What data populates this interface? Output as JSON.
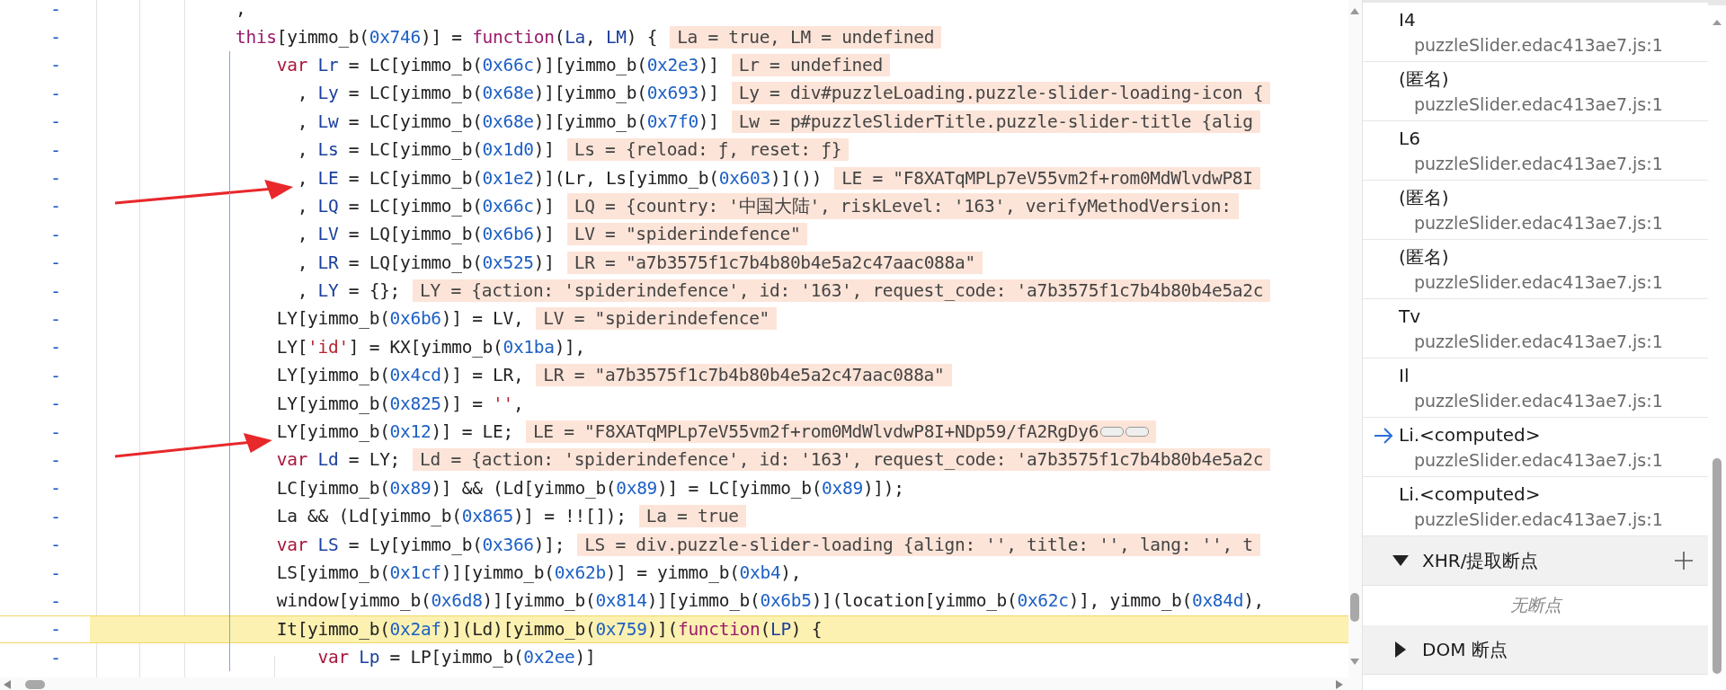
{
  "editor": {
    "lines": [
      {
        "marker": "-",
        "current": false,
        "arrow": false,
        "tokens": [
          {
            "kind": "plain",
            "text": ","
          }
        ]
      },
      {
        "marker": "-",
        "current": false,
        "arrow": false,
        "tokens": [
          {
            "kind": "keyword",
            "text": "this"
          },
          {
            "kind": "plain",
            "text": "[yimmo_b("
          },
          {
            "kind": "number",
            "text": "0x746"
          },
          {
            "kind": "plain",
            "text": ")] = "
          },
          {
            "kind": "keyword",
            "text": "function"
          },
          {
            "kind": "plain",
            "text": "("
          },
          {
            "kind": "def",
            "text": "La"
          },
          {
            "kind": "plain",
            "text": ", "
          },
          {
            "kind": "def",
            "text": "LM"
          },
          {
            "kind": "plain",
            "text": ") {"
          }
        ],
        "value": "La = true, LM = undefined"
      },
      {
        "marker": "-",
        "current": false,
        "arrow": false,
        "tokens": [
          {
            "kind": "storage",
            "text": "    var"
          },
          {
            "kind": "def",
            "text": " Lr"
          },
          {
            "kind": "plain",
            "text": " = LC[yimmo_b("
          },
          {
            "kind": "number",
            "text": "0x66c"
          },
          {
            "kind": "plain",
            "text": ")][yimmo_b("
          },
          {
            "kind": "number",
            "text": "0x2e3"
          },
          {
            "kind": "plain",
            "text": ")]"
          }
        ],
        "value": "Lr = undefined"
      },
      {
        "marker": "-",
        "current": false,
        "arrow": false,
        "tokens": [
          {
            "kind": "plain",
            "text": "      , "
          },
          {
            "kind": "def",
            "text": "Ly"
          },
          {
            "kind": "plain",
            "text": " = LC[yimmo_b("
          },
          {
            "kind": "number",
            "text": "0x68e"
          },
          {
            "kind": "plain",
            "text": ")][yimmo_b("
          },
          {
            "kind": "number",
            "text": "0x693"
          },
          {
            "kind": "plain",
            "text": ")]"
          }
        ],
        "value": "Ly = div#puzzleLoading.puzzle-slider-loading-icon {"
      },
      {
        "marker": "-",
        "current": false,
        "arrow": false,
        "tokens": [
          {
            "kind": "plain",
            "text": "      , "
          },
          {
            "kind": "def",
            "text": "Lw"
          },
          {
            "kind": "plain",
            "text": " = LC[yimmo_b("
          },
          {
            "kind": "number",
            "text": "0x68e"
          },
          {
            "kind": "plain",
            "text": ")][yimmo_b("
          },
          {
            "kind": "number",
            "text": "0x7f0"
          },
          {
            "kind": "plain",
            "text": ")]"
          }
        ],
        "value": "Lw = p#puzzleSliderTitle.puzzle-slider-title {alig"
      },
      {
        "marker": "-",
        "current": false,
        "arrow": false,
        "tokens": [
          {
            "kind": "plain",
            "text": "      , "
          },
          {
            "kind": "def",
            "text": "Ls"
          },
          {
            "kind": "plain",
            "text": " = LC[yimmo_b("
          },
          {
            "kind": "number",
            "text": "0x1d0"
          },
          {
            "kind": "plain",
            "text": ")]"
          }
        ],
        "value": "Ls = {reload: ƒ, reset: ƒ}"
      },
      {
        "marker": "-",
        "current": false,
        "arrow": true,
        "tokens": [
          {
            "kind": "plain",
            "text": "      , "
          },
          {
            "kind": "def",
            "text": "LE"
          },
          {
            "kind": "plain",
            "text": " = LC[yimmo_b("
          },
          {
            "kind": "number",
            "text": "0x1e2"
          },
          {
            "kind": "plain",
            "text": ")](Lr, Ls[yimmo_b("
          },
          {
            "kind": "number",
            "text": "0x603"
          },
          {
            "kind": "plain",
            "text": ")]())"
          }
        ],
        "value": "LE = \"F8XATqMPLp7eV55vm2f+rom0MdWlvdwP8I"
      },
      {
        "marker": "-",
        "current": false,
        "arrow": false,
        "tokens": [
          {
            "kind": "plain",
            "text": "      , "
          },
          {
            "kind": "def",
            "text": "LQ"
          },
          {
            "kind": "plain",
            "text": " = LC[yimmo_b("
          },
          {
            "kind": "number",
            "text": "0x66c"
          },
          {
            "kind": "plain",
            "text": ")]"
          }
        ],
        "value": "LQ = {country: '中国大陆', riskLevel: '163', verifyMethodVersion:"
      },
      {
        "marker": "-",
        "current": false,
        "arrow": false,
        "tokens": [
          {
            "kind": "plain",
            "text": "      , "
          },
          {
            "kind": "def",
            "text": "LV"
          },
          {
            "kind": "plain",
            "text": " = LQ[yimmo_b("
          },
          {
            "kind": "number",
            "text": "0x6b6"
          },
          {
            "kind": "plain",
            "text": ")]"
          }
        ],
        "value": "LV = \"spiderindefence\""
      },
      {
        "marker": "-",
        "current": false,
        "arrow": false,
        "tokens": [
          {
            "kind": "plain",
            "text": "      , "
          },
          {
            "kind": "def",
            "text": "LR"
          },
          {
            "kind": "plain",
            "text": " = LQ[yimmo_b("
          },
          {
            "kind": "number",
            "text": "0x525"
          },
          {
            "kind": "plain",
            "text": ")]"
          }
        ],
        "value": "LR = \"a7b3575f1c7b4b80b4e5a2c47aac088a\""
      },
      {
        "marker": "-",
        "current": false,
        "arrow": false,
        "tokens": [
          {
            "kind": "plain",
            "text": "      , "
          },
          {
            "kind": "def",
            "text": "LY"
          },
          {
            "kind": "plain",
            "text": " = {};"
          }
        ],
        "value": "LY = {action: 'spiderindefence', id: '163', request_code: 'a7b3575f1c7b4b80b4e5a2c"
      },
      {
        "marker": "-",
        "current": false,
        "arrow": false,
        "tokens": [
          {
            "kind": "plain",
            "text": "    LY[yimmo_b("
          },
          {
            "kind": "number",
            "text": "0x6b6"
          },
          {
            "kind": "plain",
            "text": ")] = LV,"
          }
        ],
        "value": "LV = \"spiderindefence\""
      },
      {
        "marker": "-",
        "current": false,
        "arrow": false,
        "tokens": [
          {
            "kind": "plain",
            "text": "    LY["
          },
          {
            "kind": "string",
            "text": "'id'"
          },
          {
            "kind": "plain",
            "text": "] = KX[yimmo_b("
          },
          {
            "kind": "number",
            "text": "0x1ba"
          },
          {
            "kind": "plain",
            "text": ")],"
          }
        ]
      },
      {
        "marker": "-",
        "current": false,
        "arrow": false,
        "tokens": [
          {
            "kind": "plain",
            "text": "    LY[yimmo_b("
          },
          {
            "kind": "number",
            "text": "0x4cd"
          },
          {
            "kind": "plain",
            "text": ")] = LR,"
          }
        ],
        "value": "LR = \"a7b3575f1c7b4b80b4e5a2c47aac088a\""
      },
      {
        "marker": "-",
        "current": false,
        "arrow": false,
        "tokens": [
          {
            "kind": "plain",
            "text": "    LY[yimmo_b("
          },
          {
            "kind": "number",
            "text": "0x825"
          },
          {
            "kind": "plain",
            "text": ")] = "
          },
          {
            "kind": "string",
            "text": "''"
          },
          {
            "kind": "plain",
            "text": ","
          }
        ]
      },
      {
        "marker": "-",
        "current": false,
        "arrow": true,
        "tokens": [
          {
            "kind": "plain",
            "text": "    LY[yimmo_b("
          },
          {
            "kind": "number",
            "text": "0x12"
          },
          {
            "kind": "plain",
            "text": ")] = LE;"
          }
        ],
        "value": "LE = \"F8XATqMPLp7eV55vm2f+rom0MdWlvdwP8I+NDp59/fA2RgDy6",
        "value_truncated": true
      },
      {
        "marker": "-",
        "current": false,
        "arrow": false,
        "tokens": [
          {
            "kind": "storage",
            "text": "    var"
          },
          {
            "kind": "def",
            "text": " Ld"
          },
          {
            "kind": "plain",
            "text": " = LY;"
          }
        ],
        "value": "Ld = {action: 'spiderindefence', id: '163', request_code: 'a7b3575f1c7b4b80b4e5a2c"
      },
      {
        "marker": "-",
        "current": false,
        "arrow": false,
        "tokens": [
          {
            "kind": "plain",
            "text": "    LC[yimmo_b("
          },
          {
            "kind": "number",
            "text": "0x89"
          },
          {
            "kind": "plain",
            "text": ")] && (Ld[yimmo_b("
          },
          {
            "kind": "number",
            "text": "0x89"
          },
          {
            "kind": "plain",
            "text": ")] = LC[yimmo_b("
          },
          {
            "kind": "number",
            "text": "0x89"
          },
          {
            "kind": "plain",
            "text": ")]);"
          }
        ]
      },
      {
        "marker": "-",
        "current": false,
        "arrow": false,
        "tokens": [
          {
            "kind": "plain",
            "text": "    La && (Ld[yimmo_b("
          },
          {
            "kind": "number",
            "text": "0x865"
          },
          {
            "kind": "plain",
            "text": ")] = !![]);"
          }
        ],
        "value": "La = true"
      },
      {
        "marker": "-",
        "current": false,
        "arrow": false,
        "tokens": [
          {
            "kind": "storage",
            "text": "    var"
          },
          {
            "kind": "def",
            "text": " LS"
          },
          {
            "kind": "plain",
            "text": " = Ly[yimmo_b("
          },
          {
            "kind": "number",
            "text": "0x366"
          },
          {
            "kind": "plain",
            "text": ")];"
          }
        ],
        "value": "LS = div.puzzle-slider-loading {align: '', title: '', lang: '', t"
      },
      {
        "marker": "-",
        "current": false,
        "arrow": false,
        "tokens": [
          {
            "kind": "plain",
            "text": "    LS[yimmo_b("
          },
          {
            "kind": "number",
            "text": "0x1cf"
          },
          {
            "kind": "plain",
            "text": ")][yimmo_b("
          },
          {
            "kind": "number",
            "text": "0x62b"
          },
          {
            "kind": "plain",
            "text": ")] = yimmo_b("
          },
          {
            "kind": "number",
            "text": "0xb4"
          },
          {
            "kind": "plain",
            "text": "),"
          }
        ]
      },
      {
        "marker": "-",
        "current": false,
        "arrow": false,
        "tokens": [
          {
            "kind": "plain",
            "text": "    window[yimmo_b("
          },
          {
            "kind": "number",
            "text": "0x6d8"
          },
          {
            "kind": "plain",
            "text": ")][yimmo_b("
          },
          {
            "kind": "number",
            "text": "0x814"
          },
          {
            "kind": "plain",
            "text": ")][yimmo_b("
          },
          {
            "kind": "number",
            "text": "0x6b5"
          },
          {
            "kind": "plain",
            "text": ")](location[yimmo_b("
          },
          {
            "kind": "number",
            "text": "0x62c"
          },
          {
            "kind": "plain",
            "text": ")], yimmo_b("
          },
          {
            "kind": "number",
            "text": "0x84d"
          },
          {
            "kind": "plain",
            "text": "),"
          }
        ]
      },
      {
        "marker": "-",
        "current": true,
        "arrow": false,
        "tokens": [
          {
            "kind": "plain",
            "text": "    It[yimmo_b("
          },
          {
            "kind": "number",
            "text": "0x2af"
          },
          {
            "kind": "plain",
            "text": ")](Ld)[yimmo_b("
          },
          {
            "kind": "number",
            "text": "0x759"
          },
          {
            "kind": "plain",
            "text": ")]("
          },
          {
            "kind": "keyword",
            "text": "function"
          },
          {
            "kind": "plain",
            "text": "("
          },
          {
            "kind": "def",
            "text": "LP"
          },
          {
            "kind": "plain",
            "text": ") {"
          }
        ]
      },
      {
        "marker": "-",
        "current": false,
        "arrow": false,
        "tokens": [
          {
            "kind": "storage",
            "text": "        var"
          },
          {
            "kind": "def",
            "text": " Lp"
          },
          {
            "kind": "plain",
            "text": " = LP[yimmo_b("
          },
          {
            "kind": "number",
            "text": "0x2ee"
          },
          {
            "kind": "plain",
            "text": ")]"
          }
        ]
      }
    ]
  },
  "call_stack": {
    "frames": [
      {
        "name": "I4",
        "location": "puzzleSlider.edac413ae7.js:1",
        "selected": false
      },
      {
        "name": "(匿名)",
        "location": "puzzleSlider.edac413ae7.js:1",
        "selected": false
      },
      {
        "name": "L6",
        "location": "puzzleSlider.edac413ae7.js:1",
        "selected": false
      },
      {
        "name": "(匿名)",
        "location": "puzzleSlider.edac413ae7.js:1",
        "selected": false
      },
      {
        "name": "(匿名)",
        "location": "puzzleSlider.edac413ae7.js:1",
        "selected": false
      },
      {
        "name": "Tv",
        "location": "puzzleSlider.edac413ae7.js:1",
        "selected": false
      },
      {
        "name": "Il",
        "location": "puzzleSlider.edac413ae7.js:1",
        "selected": false
      },
      {
        "name": "Li.<computed>",
        "location": "puzzleSlider.edac413ae7.js:1",
        "selected": true
      },
      {
        "name": "Li.<computed>",
        "location": "puzzleSlider.edac413ae7.js:1",
        "selected": false
      }
    ]
  },
  "sections": [
    {
      "title": "XHR/提取断点",
      "expanded": true,
      "add_button": true,
      "empty_text": "无断点"
    },
    {
      "title": "DOM 断点",
      "expanded": false,
      "add_button": false
    }
  ]
}
